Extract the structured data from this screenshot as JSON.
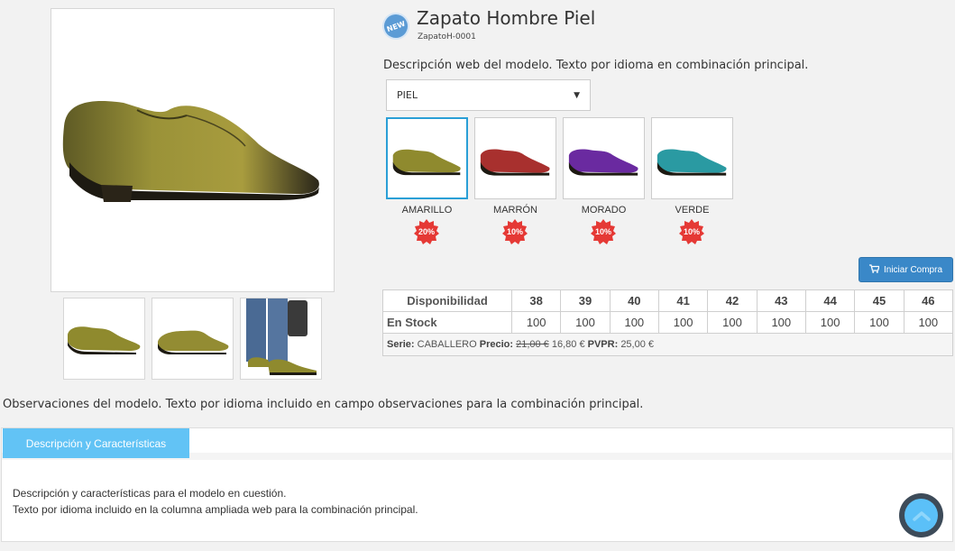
{
  "product": {
    "title": "Zapato Hombre Piel",
    "ref": "ZapatoH-0001",
    "badge": "NEW",
    "description": "Descripción web del modelo. Texto por idioma en combinación principal.",
    "material_select": "PIEL"
  },
  "colors": [
    {
      "label": "AMARILLO",
      "discount": "20%",
      "hex": "#8f8a2e"
    },
    {
      "label": "MARRÓN",
      "discount": "10%",
      "hex": "#a8302e"
    },
    {
      "label": "MORADO",
      "discount": "10%",
      "hex": "#6a2aa0"
    },
    {
      "label": "VERDE",
      "discount": "10%",
      "hex": "#2a9aa2"
    }
  ],
  "buy_button": "Iniciar Compra",
  "stock_table": {
    "header_label": "Disponibilidad",
    "sizes": [
      "38",
      "39",
      "40",
      "41",
      "42",
      "43",
      "44",
      "45",
      "46"
    ],
    "row_label": "En Stock",
    "values": [
      "100",
      "100",
      "100",
      "100",
      "100",
      "100",
      "100",
      "100",
      "100"
    ],
    "serie_label": "Serie:",
    "serie_value": "CABALLERO",
    "precio_label": "Precio:",
    "precio_old": "21,00 €",
    "precio_new": "16,80 €",
    "pvpr_label": "PVPR:",
    "pvpr_value": "25,00 €"
  },
  "observations": "Observaciones del modelo. Texto por idioma incluido en campo observaciones para la combinación principal.",
  "tabs": {
    "active_label": "Descripción y Características",
    "body_line1": "Descripción y características para el modelo en cuestión.",
    "body_line2": "Texto por idioma incluido en la columna ampliada web para la combinación principal."
  },
  "theme": {
    "accent": "#2a9fd6",
    "tab": "#62c3f5",
    "button": "#3a88c8",
    "discount": "#e53935"
  }
}
